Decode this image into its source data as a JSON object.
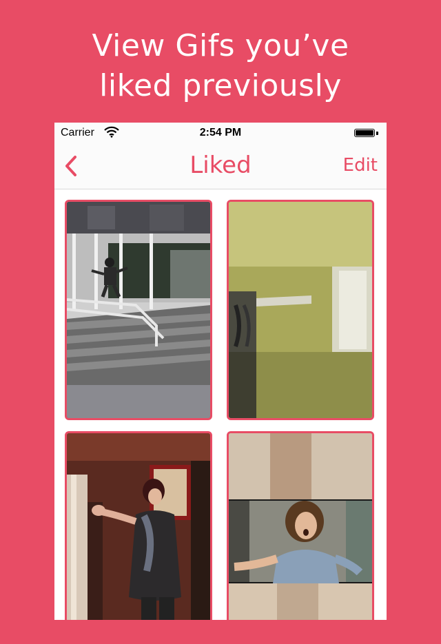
{
  "headline": {
    "line1": "View Gifs you’ve",
    "line2": "liked previously"
  },
  "status_bar": {
    "carrier": "Carrier",
    "time": "2:54 PM",
    "wifi_icon": "wifi-icon",
    "battery_icon": "battery-icon"
  },
  "nav": {
    "back_icon": "chevron-left-icon",
    "title": "Liked",
    "edit_label": "Edit"
  },
  "gifs": [
    {
      "subject": "skateboarder-rail-stairs"
    },
    {
      "subject": "coat-rack-falling"
    },
    {
      "subject": "woman-high-five-hallway"
    },
    {
      "subject": "man-surprised-face"
    }
  ],
  "colors": {
    "brand": "#e84c65",
    "nav_background": "#fbfbfb"
  }
}
